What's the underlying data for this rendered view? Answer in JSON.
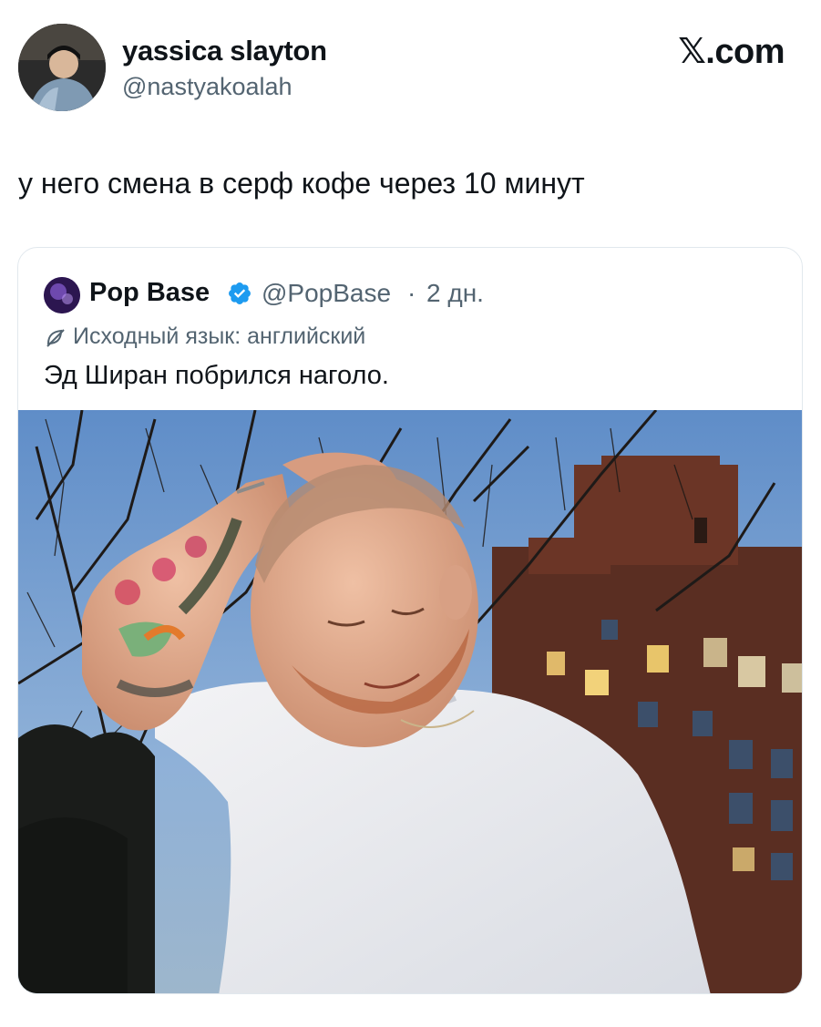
{
  "author": {
    "name": "yassica slayton",
    "handle": "@nastyakoalah",
    "avatar_icon": "profile-photo"
  },
  "site_logo": "𝕏.com",
  "tweet": {
    "text": "у него смена в серф кофе через 10 минут"
  },
  "quoted_tweet": {
    "name": "Pop Base",
    "verified_icon": "verified-badge-icon",
    "handle": "@PopBase",
    "separator": "·",
    "time": "2 дн.",
    "translate_label": "Исходный язык: английский",
    "text": "Эд Ширан побрился наголо.",
    "media": "photo"
  },
  "colors": {
    "text_primary": "#0f1419",
    "text_secondary": "#536471",
    "verified": "#1d9bf0",
    "card_border": "#e1e8ed"
  }
}
